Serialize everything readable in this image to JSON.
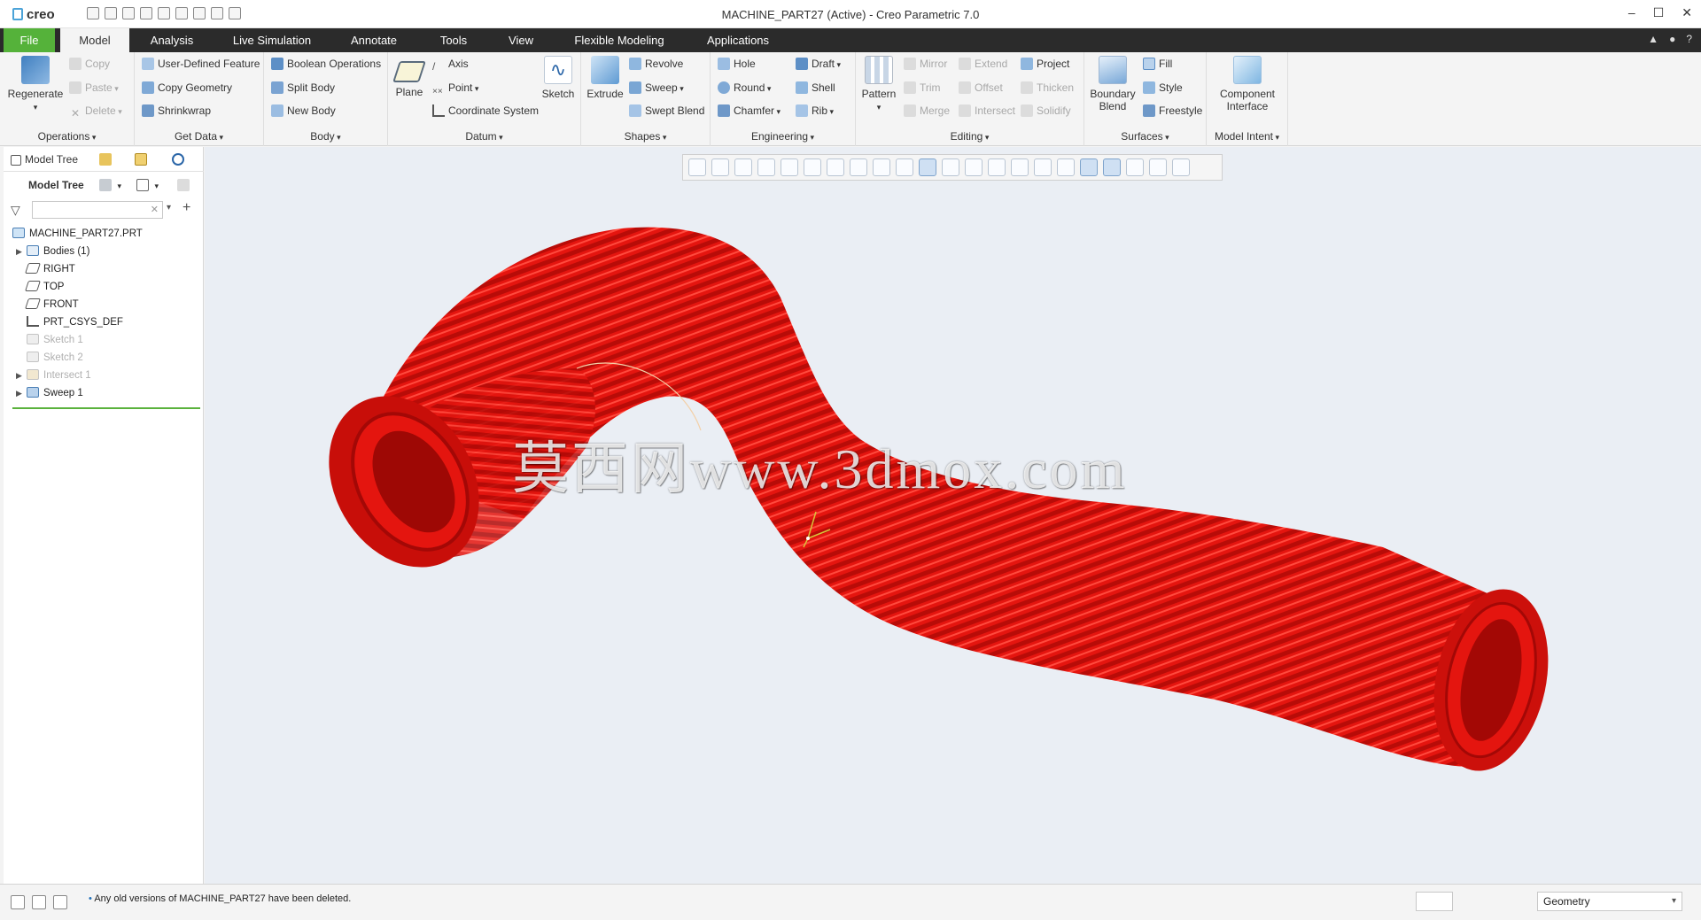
{
  "app": {
    "logo": "creo",
    "window_title": "MACHINE_PART27 (Active) - Creo Parametric 7.0",
    "window_controls": [
      "–",
      "☐",
      "✕"
    ]
  },
  "tabs": [
    "File",
    "Model",
    "Analysis",
    "Live Simulation",
    "Annotate",
    "Tools",
    "View",
    "Flexible Modeling",
    "Applications"
  ],
  "ribbon": {
    "operations": {
      "label": "Operations",
      "regenerate": "Regenerate",
      "copy": "Copy",
      "paste": "Paste",
      "delete": "Delete"
    },
    "get_data": {
      "label": "Get Data",
      "udf": "User-Defined Feature",
      "copy_geometry": "Copy Geometry",
      "shrinkwrap": "Shrinkwrap"
    },
    "body": {
      "label": "Body",
      "boolean": "Boolean Operations",
      "split": "Split Body",
      "new": "New Body"
    },
    "datum": {
      "label": "Datum",
      "plane": "Plane",
      "axis": "Axis",
      "point": "Point",
      "csys": "Coordinate System",
      "sketch": "Sketch"
    },
    "shapes": {
      "label": "Shapes",
      "extrude": "Extrude",
      "revolve": "Revolve",
      "sweep": "Sweep",
      "swept_blend": "Swept Blend"
    },
    "engineering": {
      "label": "Engineering",
      "hole": "Hole",
      "round": "Round",
      "chamfer": "Chamfer",
      "draft": "Draft",
      "shell": "Shell",
      "rib": "Rib"
    },
    "editing": {
      "label": "Editing",
      "pattern": "Pattern",
      "mirror": "Mirror",
      "trim": "Trim",
      "merge": "Merge",
      "extend": "Extend",
      "offset": "Offset",
      "intersect": "Intersect",
      "project": "Project",
      "thicken": "Thicken",
      "solidify": "Solidify"
    },
    "surfaces": {
      "label": "Surfaces",
      "boundary_blend": "Boundary Blend",
      "fill": "Fill",
      "style": "Style",
      "freestyle": "Freestyle"
    },
    "model_intent": {
      "label": "Model Intent",
      "component_interface": "Component Interface"
    }
  },
  "model_tree": {
    "tab_label": "Model Tree",
    "header": "Model Tree",
    "items": [
      {
        "label": "MACHINE_PART27.PRT"
      },
      {
        "label": "Bodies (1)"
      },
      {
        "label": "RIGHT"
      },
      {
        "label": "TOP"
      },
      {
        "label": "FRONT"
      },
      {
        "label": "PRT_CSYS_DEF"
      },
      {
        "label": "Sketch 1"
      },
      {
        "label": "Sketch 2"
      },
      {
        "label": "Intersect 1"
      },
      {
        "label": "Sweep 1"
      }
    ]
  },
  "viewport": {
    "watermark": "莫西网www.3dmox.com",
    "model_color": "#e8140f",
    "background": "#eaeef4"
  },
  "status": {
    "message": "Any old versions of MACHINE_PART27 have been deleted.",
    "filter_value": "Geometry"
  }
}
